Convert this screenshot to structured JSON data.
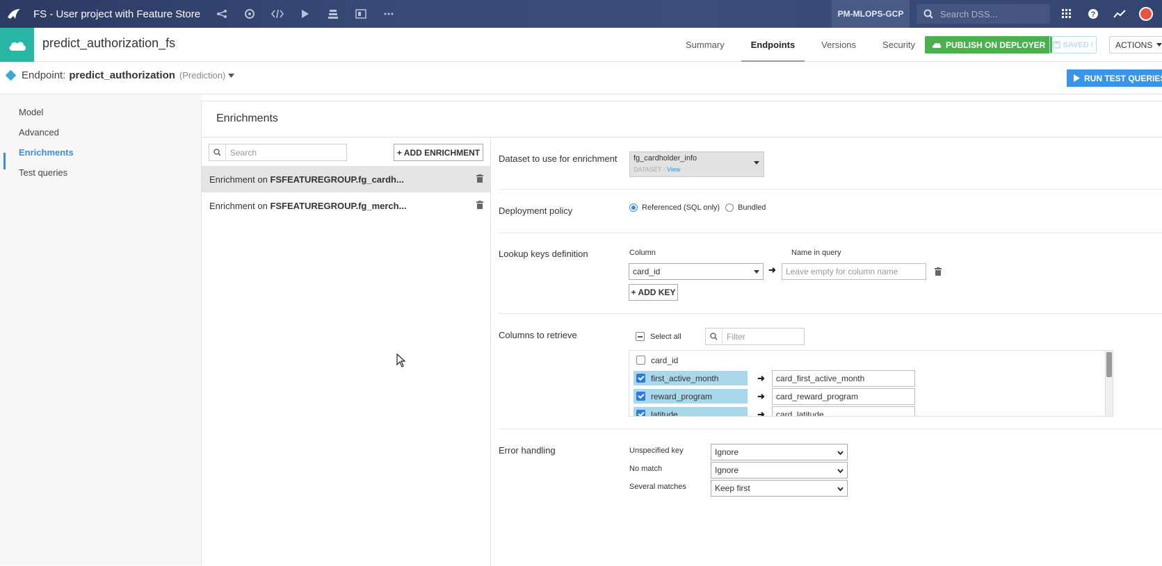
{
  "topbar": {
    "project_title": "FS - User project with Feature Store",
    "instance": "PM-MLOPS-GCP",
    "search_placeholder": "Search DSS..."
  },
  "header": {
    "service_name": "predict_authorization_fs",
    "tabs": [
      {
        "label": "Summary"
      },
      {
        "label": "Endpoints"
      },
      {
        "label": "Versions"
      },
      {
        "label": "Security"
      }
    ],
    "publish_label": "PUBLISH ON DEPLOYER",
    "saved_label": "SAVED !",
    "actions_label": "ACTIONS"
  },
  "endpoint": {
    "label": "Endpoint:",
    "name": "predict_authorization",
    "type": "(Prediction)",
    "run_test_label": "RUN TEST QUERIES"
  },
  "leftnav": {
    "items": [
      {
        "label": "Model"
      },
      {
        "label": "Advanced"
      },
      {
        "label": "Enrichments"
      },
      {
        "label": "Test queries"
      }
    ]
  },
  "main": {
    "heading": "Enrichments",
    "search_placeholder": "Search",
    "add_enrichment_label": "+ ADD ENRICHMENT",
    "enrichments": [
      {
        "prefix": "Enrichment on ",
        "name": "FSFEATUREGROUP.fg_cardh..."
      },
      {
        "prefix": "Enrichment on ",
        "name": "FSFEATUREGROUP.fg_merch..."
      }
    ]
  },
  "detail": {
    "dataset_label": "Dataset to use for enrichment",
    "dataset_name": "fg_cardholder_info",
    "dataset_kind": "DATASET",
    "dataset_sep": " - ",
    "dataset_view": "View",
    "deployment_label": "Deployment policy",
    "policy_referenced": "Referenced (SQL only)",
    "policy_bundled": "Bundled",
    "lookup_label": "Lookup keys definition",
    "column_header": "Column",
    "name_in_query_header": "Name in query",
    "lookup_column": "card_id",
    "name_in_query_placeholder": "Leave empty for column name",
    "add_key_label": "+ ADD KEY",
    "columns_label": "Columns to retrieve",
    "select_all_label": "Select all",
    "filter_placeholder": "Filter",
    "columns": [
      {
        "name": "card_id",
        "checked": false,
        "alias": ""
      },
      {
        "name": "first_active_month",
        "checked": true,
        "alias": "card_first_active_month"
      },
      {
        "name": "reward_program",
        "checked": true,
        "alias": "card_reward_program"
      },
      {
        "name": "latitude",
        "checked": true,
        "alias": "card_latitude"
      }
    ],
    "error_label": "Error handling",
    "unspecified_key_label": "Unspecified key",
    "unspecified_key_value": "Ignore",
    "no_match_label": "No match",
    "no_match_value": "Ignore",
    "several_matches_label": "Several matches",
    "several_matches_value": "Keep first"
  },
  "colors": {
    "accent": "#3a8ee0",
    "publish": "#4caf50",
    "cloud": "#29b6a5",
    "run_test": "#3a95e8",
    "column_highlight": "#a8d8ea"
  }
}
